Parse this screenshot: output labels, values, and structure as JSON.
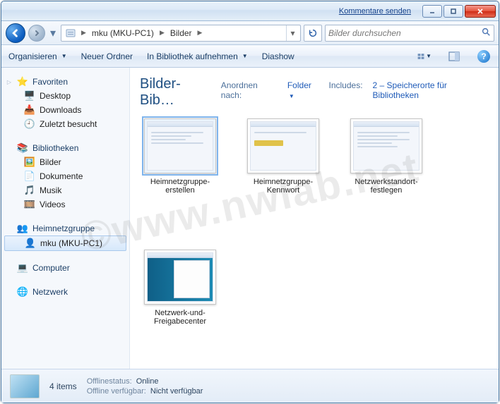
{
  "titlebar": {
    "feedback_link": "Kommentare senden"
  },
  "breadcrumb": {
    "segments": [
      "mku (MKU-PC1)",
      "Bilder"
    ]
  },
  "search": {
    "placeholder": "Bilder durchsuchen"
  },
  "toolbar": {
    "organize": "Organisieren",
    "new_folder": "Neuer Ordner",
    "include": "In Bibliothek aufnehmen",
    "slideshow": "Diashow"
  },
  "sidebar": {
    "favorites": {
      "label": "Favoriten",
      "items": [
        "Desktop",
        "Downloads",
        "Zuletzt besucht"
      ]
    },
    "libraries": {
      "label": "Bibliotheken",
      "items": [
        "Bilder",
        "Dokumente",
        "Musik",
        "Videos"
      ]
    },
    "homegroup": {
      "label": "Heimnetzgruppe",
      "items": [
        "mku (MKU-PC1)"
      ]
    },
    "computer": {
      "label": "Computer"
    },
    "network": {
      "label": "Netzwerk"
    }
  },
  "content": {
    "title": "Bilder-Bib…",
    "arrange_label": "Anordnen nach:",
    "arrange_value": "Folder",
    "includes_label": "Includes:",
    "includes_value": "2 – Speicherorte für Bibliotheken",
    "items": [
      {
        "name": "Heimnetzgruppe-erstellen"
      },
      {
        "name": "Heimnetzgruppe-Kennwort"
      },
      {
        "name": "Netzwerkstandort-festlegen"
      },
      {
        "name": "Netzwerk-und-Freigabecenter"
      }
    ]
  },
  "status": {
    "count": "4 items",
    "offline_status_label": "Offlinestatus:",
    "offline_status_value": "Online",
    "offline_avail_label": "Offline verfügbar:",
    "offline_avail_value": "Nicht verfügbar"
  },
  "watermark": "©www.nwlab.net"
}
